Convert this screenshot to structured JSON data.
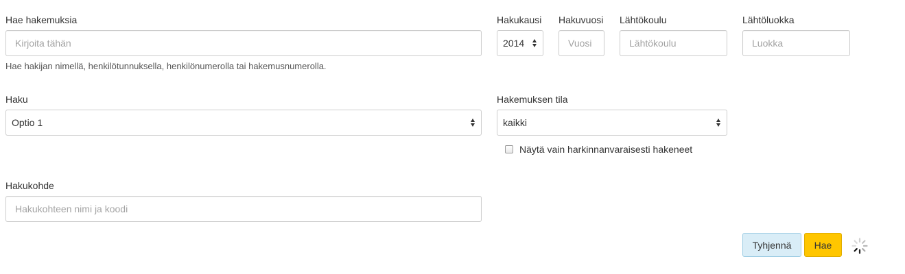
{
  "search": {
    "label": "Hae hakemuksia",
    "placeholder": "Kirjoita tähän",
    "help": "Hae hakijan nimellä, henkilötunnuksella, henkilönumerolla tai hakemusnumerolla."
  },
  "term": {
    "label": "Hakukausi",
    "value": "2014"
  },
  "year": {
    "label": "Hakuvuosi",
    "placeholder": "Vuosi"
  },
  "school": {
    "label": "Lähtökoulu",
    "placeholder": "Lähtökoulu"
  },
  "grade": {
    "label": "Lähtöluokka",
    "placeholder": "Luokka"
  },
  "haku": {
    "label": "Haku",
    "value": "Optio 1"
  },
  "status": {
    "label": "Hakemuksen tila",
    "value": "kaikki"
  },
  "discretionary": {
    "label": "Näytä vain harkinnanvaraisesti hakeneet",
    "checked": false
  },
  "target": {
    "label": "Hakukohde",
    "placeholder": "Hakukohteen nimi ja koodi"
  },
  "actions": {
    "clear_label": "Tyhjennä",
    "search_label": "Hae"
  },
  "icons": {
    "spinner": "loading-spinner-icon",
    "select_arrows": "select-arrows-icon"
  },
  "colors": {
    "search_button": "#ffc600",
    "clear_button": "#d9edf7"
  }
}
